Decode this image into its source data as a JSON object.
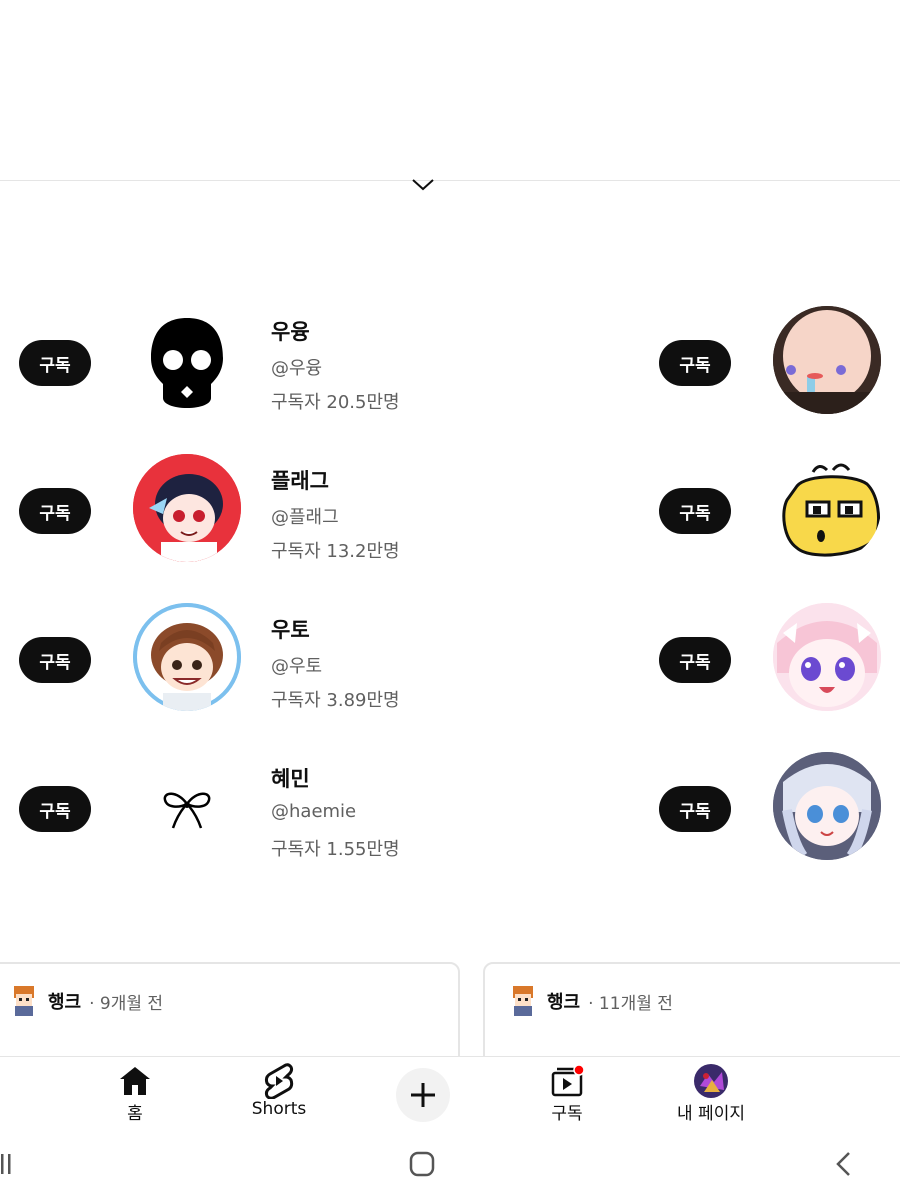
{
  "channels_left": [
    {
      "name": "우융",
      "handle": "@우융",
      "subscribers": "구독자 20.5만명",
      "subscribe_label": "구독"
    },
    {
      "name": "플래그",
      "handle": "@플래그",
      "subscribers": "구독자 13.2만명",
      "subscribe_label": "구독"
    },
    {
      "name": "우토",
      "handle": "@우토",
      "subscribers": "구독자 3.89만명",
      "subscribe_label": "구독"
    },
    {
      "name": "혜민",
      "handle": "@haemie",
      "subscribers": "구독자 1.55만명",
      "subscribe_label": "구독"
    }
  ],
  "channels_right": [
    {
      "subscribe_label": "구독"
    },
    {
      "subscribe_label": "구독"
    },
    {
      "subscribe_label": "구독"
    },
    {
      "subscribe_label": "구독"
    }
  ],
  "posts": [
    {
      "author": "행크",
      "time": " · 9개월 전"
    },
    {
      "author": "행크",
      "time": " · 11개월 전"
    }
  ],
  "bottom_nav": {
    "home": "홈",
    "shorts": "Shorts",
    "subscriptions": "구독",
    "my_page": "내 페이지",
    "subscriptions_badge_color": "#ff0000"
  },
  "colors": {
    "button_bg": "#0f0f0f",
    "secondary_text": "#606060"
  }
}
